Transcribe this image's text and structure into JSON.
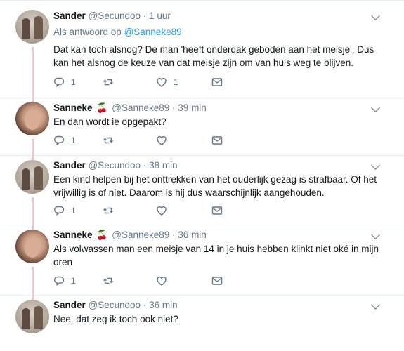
{
  "tweets": [
    {
      "name": "Sander",
      "handle": "@Secundoo",
      "sep": "·",
      "time": "1 uur",
      "reply_prefix": "Als antwoord op",
      "reply_handle": "@Sanneke89",
      "text": "Dat kan toch alsnog? De man 'heeft onderdak geboden aan het meisje'. Dus kan het alsnog de keuze van dat meisje zijn om van huis weg te blijven.",
      "replies": "1",
      "retweets": "",
      "likes": "1"
    },
    {
      "name": "Sanneke",
      "emoji": "🍒",
      "handle": "@Sanneke89",
      "sep": "·",
      "time": "39 min",
      "text": "En dan wordt ie opgepakt?",
      "replies": "1",
      "retweets": "",
      "likes": ""
    },
    {
      "name": "Sander",
      "handle": "@Secundoo",
      "sep": "·",
      "time": "38 min",
      "text": "Een kind helpen bij het onttrekken van het ouderlijk gezag is strafbaar. Of het vrijwillig is of niet. Daarom is hij dus waarschijnlijk aangehouden.",
      "replies": "1",
      "retweets": "",
      "likes": ""
    },
    {
      "name": "Sanneke",
      "emoji": "🍒",
      "handle": "@Sanneke89",
      "sep": "·",
      "time": "36 min",
      "text": "Als volwassen man een meisje van 14 in je huis hebben klinkt niet oké in mijn oren",
      "replies": "1",
      "retweets": "",
      "likes": ""
    },
    {
      "name": "Sander",
      "handle": "@Secundoo",
      "sep": "·",
      "time": "36 min",
      "text": "Nee, dat zeg ik toch ook niet?"
    }
  ],
  "icons": {
    "reply": "reply-icon",
    "retweet": "retweet-icon",
    "like": "heart-icon",
    "dm": "envelope-icon",
    "more": "chevron-down-icon"
  },
  "colors": {
    "link": "#1da1f2",
    "thread_line": "#f1c5cd",
    "muted": "#657786",
    "text": "#14171a"
  }
}
